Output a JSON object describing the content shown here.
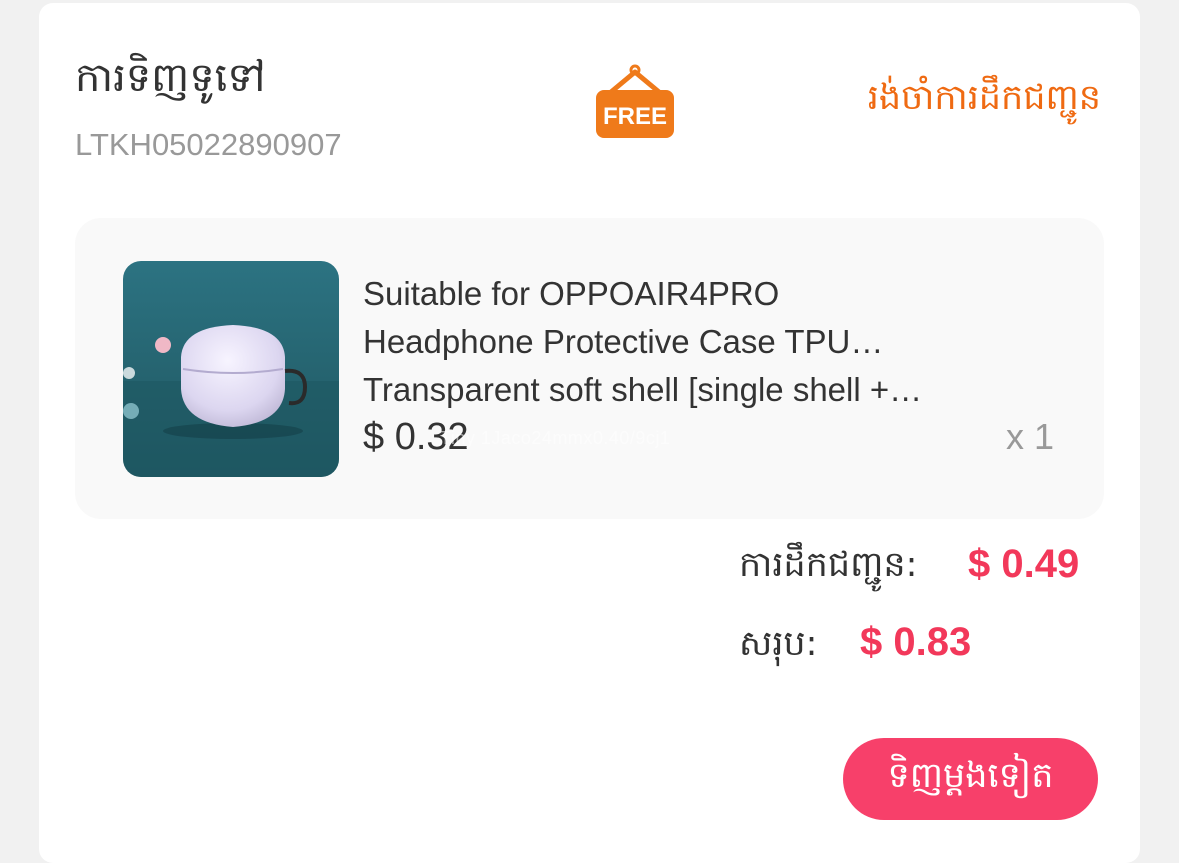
{
  "order": {
    "type_label": "ការទិញទូទៅ",
    "order_number": "LTKH05022890907",
    "badge_text": "FREE",
    "status": "រង់ចាំការដឹកជញ្ជូន"
  },
  "product": {
    "title_lines": [
      "Suitable for OPPOAIR4PRO",
      "Headphone Protective Case TPU…",
      "Transparent soft shell [single shell +…"
    ],
    "price": "$ 0.32",
    "quantity": "x 1",
    "watermark": "Tiny 1Jaco24mmx0.40/9cj1"
  },
  "summary": {
    "shipping_label": "ការដឹកជញ្ជូន:",
    "shipping_value": "$ 0.49",
    "total_label": "សរុប:",
    "total_value": "$ 0.83"
  },
  "actions": {
    "rebuy_label": "ទិញម្តងទៀត"
  },
  "colors": {
    "accent": "#f2385a",
    "status": "#ef6a12",
    "button": "#f7406a"
  }
}
